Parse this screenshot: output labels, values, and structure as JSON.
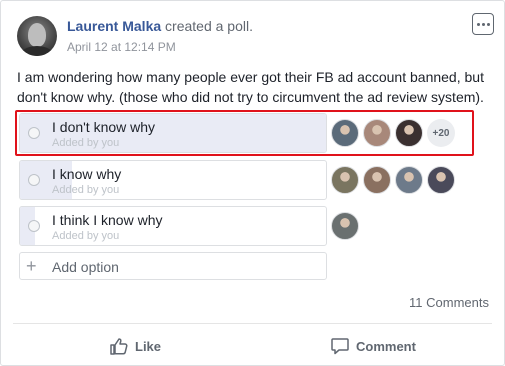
{
  "post": {
    "author": "Laurent Malka",
    "action": " created a poll.",
    "timestamp": "April 12 at 12:14 PM",
    "text": "I am wondering how many people ever got their FB ad account banned, but don't know why. (those who did not try to circumvent the ad review system)."
  },
  "poll": {
    "options": [
      {
        "label": "I don't know why",
        "sub": "Added by you",
        "vote_share": 1.0,
        "voter_colors": [
          "#5b6b7a",
          "#a8887a",
          "#3a3030"
        ],
        "more_count": "+20"
      },
      {
        "label": "I know why",
        "sub": "Added by you",
        "vote_share": 0.17,
        "voter_colors": [
          "#7a7560",
          "#8a7060",
          "#6d7a8a",
          "#4a4a5a"
        ]
      },
      {
        "label": "I think I know why",
        "sub": "Added by you",
        "vote_share": 0.05,
        "voter_colors": [
          "#6a7070"
        ]
      }
    ],
    "add_option_label": "Add option"
  },
  "footer": {
    "comments_count": "11 Comments",
    "like_label": "Like",
    "comment_label": "Comment"
  },
  "colors": {
    "author_link": "#385898",
    "highlight_border": "#e0121b",
    "vote_fill": "#e9ebf5"
  },
  "icons": {
    "more": "more-options-icon",
    "like": "thumbs-up-icon",
    "comment": "comment-bubble-icon",
    "add": "plus-icon"
  }
}
